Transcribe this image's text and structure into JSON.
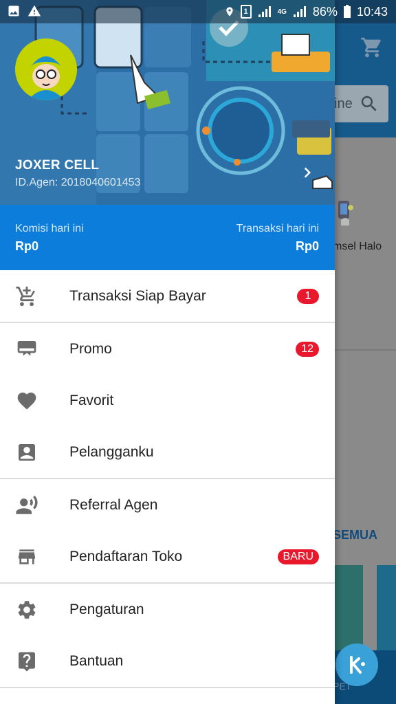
{
  "status_bar": {
    "battery": "86%",
    "time": "10:43",
    "network": "4G",
    "sim_badge": "1",
    "icons": [
      "image-icon",
      "warning-icon",
      "location-icon",
      "sim-icon",
      "signal-icon",
      "battery-icon"
    ]
  },
  "background_app": {
    "search_text": "ine",
    "halo_label": "msel Halo",
    "see_all": "SEMUA",
    "bottom_label": "PET"
  },
  "profile": {
    "name": "JOXER CELL",
    "agent_id": "ID.Agen: 2018040601453"
  },
  "stats": {
    "commission_label": "Komisi hari ini",
    "commission_value": "Rp0",
    "transaction_label": "Transaksi hari ini",
    "transaction_value": "Rp0"
  },
  "menu": {
    "items": [
      {
        "label": "Transaksi Siap Bayar",
        "icon": "cart-icon",
        "badge": "1"
      },
      {
        "label": "Promo",
        "icon": "promo-icon",
        "badge": "12"
      },
      {
        "label": "Favorit",
        "icon": "heart-icon",
        "badge": ""
      },
      {
        "label": "Pelangganku",
        "icon": "contact-icon",
        "badge": ""
      },
      {
        "label": "Referral Agen",
        "icon": "referral-icon",
        "badge": ""
      },
      {
        "label": "Pendaftaran Toko",
        "icon": "store-icon",
        "badge": "BARU"
      },
      {
        "label": "Pengaturan",
        "icon": "gear-icon",
        "badge": ""
      },
      {
        "label": "Bantuan",
        "icon": "help-icon",
        "badge": ""
      }
    ]
  },
  "colors": {
    "primary": "#0d7ddb",
    "header": "#2b6fa6",
    "badge": "#e8192c",
    "icon_gray": "#6b6b6b"
  }
}
